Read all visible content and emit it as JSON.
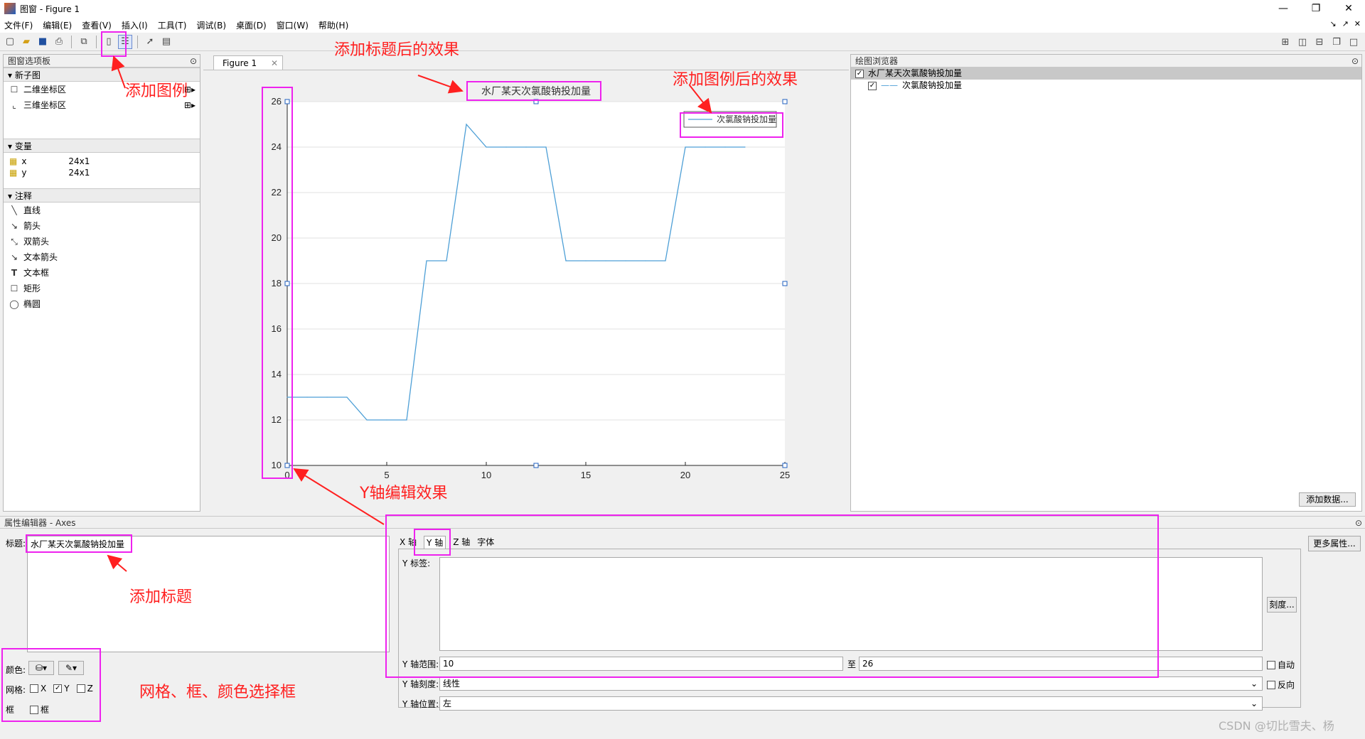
{
  "window": {
    "title": "图窗 - Figure 1",
    "controls": [
      "—",
      "❐",
      "✕"
    ]
  },
  "menu": [
    "文件(F)",
    "编辑(E)",
    "查看(V)",
    "插入(I)",
    "工具(T)",
    "调试(B)",
    "桌面(D)",
    "窗口(W)",
    "帮助(H)"
  ],
  "palette": {
    "header": "图窗选项板",
    "sections": {
      "new_subplot": "新子图",
      "variables": "变量",
      "annotations": "注释"
    },
    "subplot_items": [
      "二维坐标区",
      "三维坐标区"
    ],
    "variables": [
      {
        "name": "x",
        "size": "24x1"
      },
      {
        "name": "y",
        "size": "24x1"
      }
    ],
    "annotation_items": [
      "直线",
      "箭头",
      "双箭头",
      "文本箭头",
      "文本框",
      "矩形",
      "椭圆"
    ]
  },
  "figure": {
    "tab_label": "Figure 1"
  },
  "chart_data": {
    "type": "line",
    "title": "水厂某天次氯酸钠投加量",
    "legend": {
      "entries": [
        "次氯酸钠投加量"
      ],
      "placement": "top-right"
    },
    "xlim": [
      0,
      25
    ],
    "ylim": [
      10,
      26
    ],
    "xticks": [
      0,
      5,
      10,
      15,
      20,
      25
    ],
    "yticks": [
      10,
      12,
      14,
      16,
      18,
      20,
      22,
      24,
      26
    ],
    "grid": "horizontal",
    "series": [
      {
        "name": "次氯酸钠投加量",
        "color": "#4d9fd6",
        "x": [
          0,
          1,
          2,
          3,
          4,
          5,
          6,
          7,
          8,
          9,
          10,
          11,
          12,
          13,
          14,
          15,
          16,
          17,
          18,
          19,
          20,
          21,
          22,
          23
        ],
        "values": [
          13,
          13,
          13,
          13,
          12,
          12,
          12,
          19,
          19,
          25,
          24,
          24,
          24,
          24,
          19,
          19,
          19,
          19,
          19,
          19,
          24,
          24,
          24,
          24
        ]
      }
    ]
  },
  "browser": {
    "header": "绘图浏览器",
    "items": [
      {
        "label": "水厂某天次氯酸钠投加量",
        "checked": true
      },
      {
        "label": "次氯酸钠投加量",
        "checked": true
      }
    ],
    "add_data_button": "添加数据..."
  },
  "property_editor": {
    "header": "属性编辑器 - Axes",
    "title_label": "标题:",
    "title_value": "水厂某天次氯酸钠投加量",
    "color_label": "颜色:",
    "grid_label": "网格:",
    "grid_options": [
      {
        "label": "X",
        "checked": false
      },
      {
        "label": "Y",
        "checked": true
      },
      {
        "label": "Z",
        "checked": false
      }
    ],
    "box_label": "框",
    "box_option": "框",
    "tabs": [
      "X 轴",
      "Y 轴",
      "Z 轴",
      "字体"
    ],
    "active_tab": "Y 轴",
    "y_label_label": "Y 标签:",
    "y_label_value": "",
    "ticks_button": "刻度...",
    "y_range_label": "Y 轴范围:",
    "y_range_min": "10",
    "y_range_to": "至",
    "y_range_max": "26",
    "auto_label": "自动",
    "y_scale_label": "Y 轴刻度:",
    "y_scale_value": "线性",
    "reverse_label": "反向",
    "y_location_label": "Y 轴位置:",
    "y_location_value": "左",
    "more_props_button": "更多属性..."
  },
  "annotations": {
    "add_title_effect": "添加标题后的效果",
    "add_legend_effect": "添加图例后的效果",
    "add_legend": "添加图例",
    "y_axis_edit_effect": "Y轴编辑效果",
    "add_title": "添加标题",
    "grid_box_color": "网格、框、颜色选择框"
  },
  "watermark": "CSDN @切比雪夫、杨"
}
